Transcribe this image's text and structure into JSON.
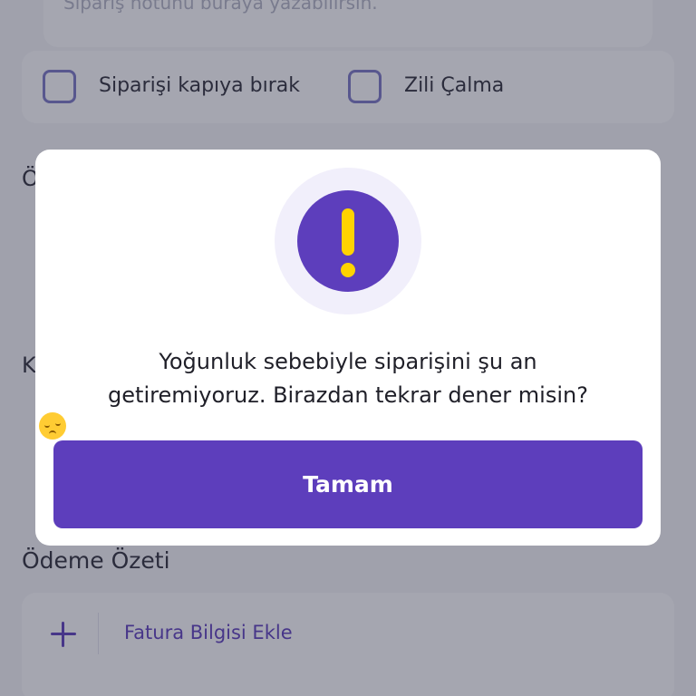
{
  "background": {
    "note_placeholder": "Sipariş notunu buraya yazabilirsin.",
    "options": [
      {
        "label": "Siparişi kapıya bırak"
      },
      {
        "label": "Zili Çalma"
      }
    ],
    "section_letters": [
      "Ö",
      "K"
    ],
    "summary_title": "Ödeme Özeti",
    "invoice_label": "Fatura Bilgisi Ekle"
  },
  "modal": {
    "icon": "exclamation-icon",
    "message_line1": "Yoğunluk sebebiyle siparişini şu an",
    "message_line2": "getiremiyoruz. Birazdan tekrar dener misin?",
    "emoji": "pensive-face-emoji",
    "button_label": "Tamam"
  },
  "colors": {
    "brand_purple": "#5d3ebc",
    "alert_yellow": "#ffd300",
    "overlay": "rgba(40,44,66,0.42)"
  }
}
